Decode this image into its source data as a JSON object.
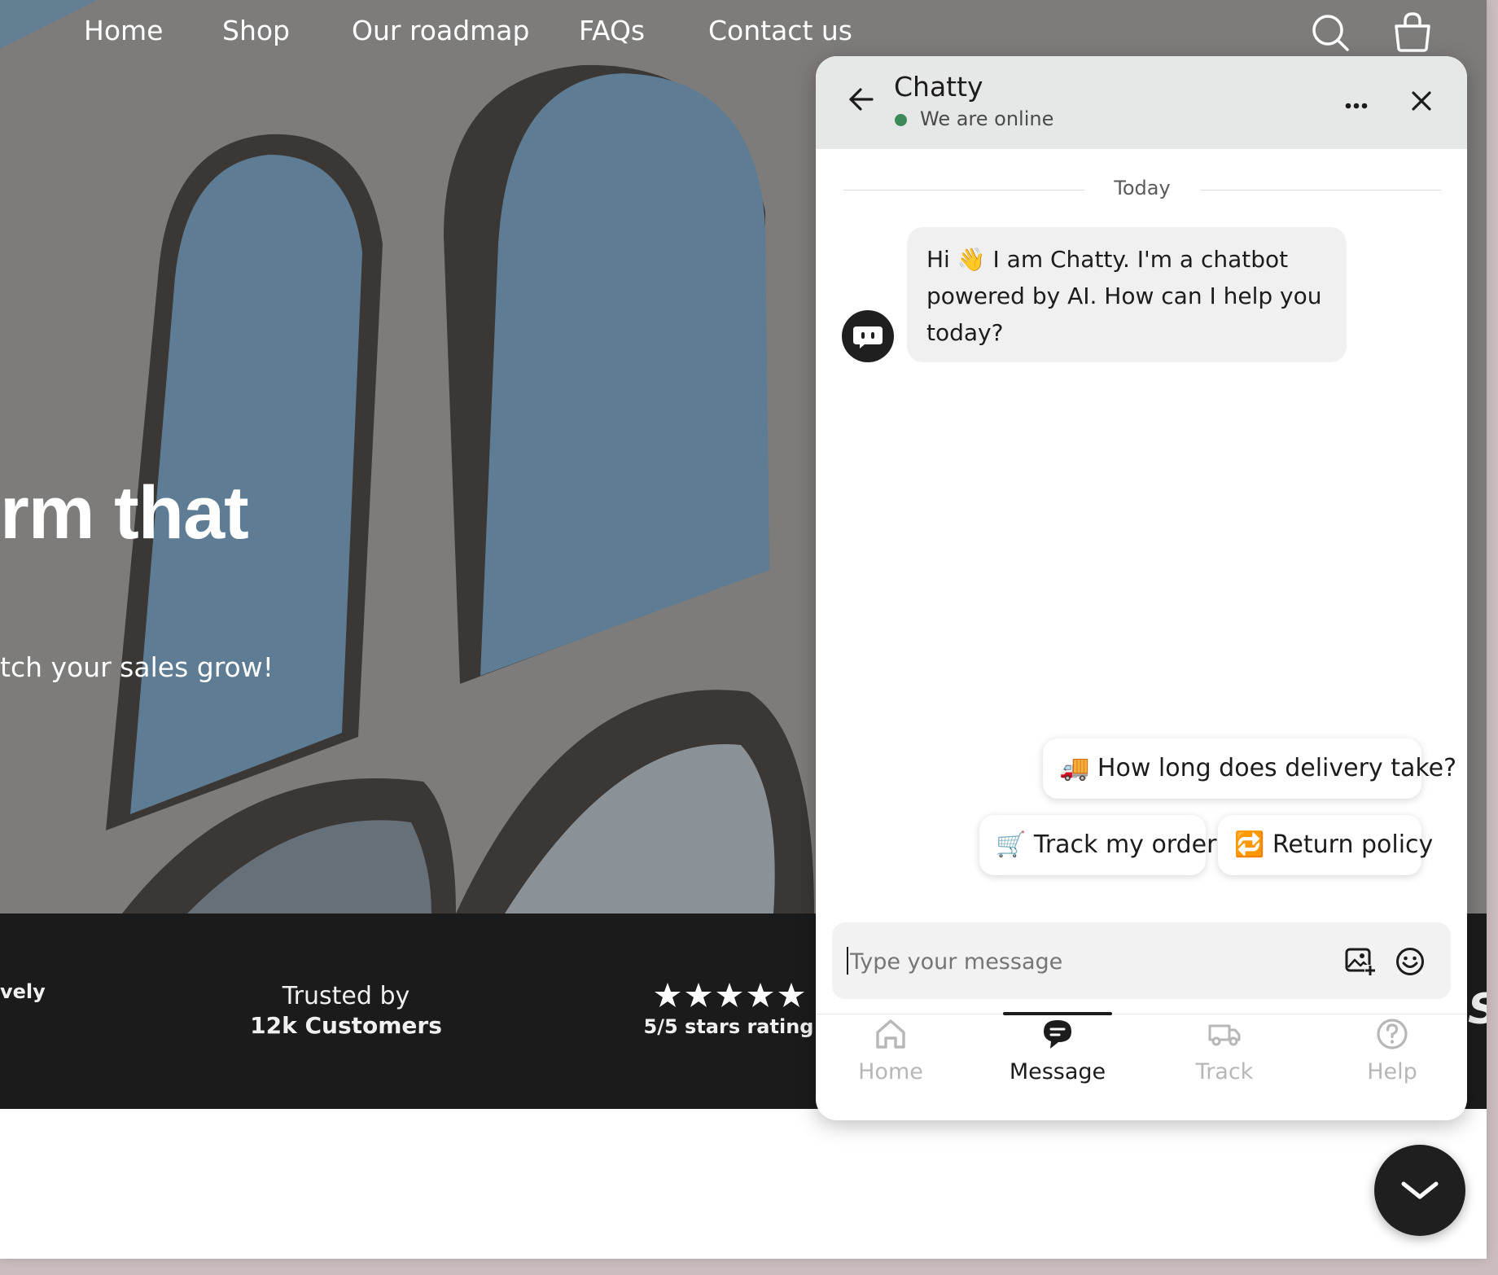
{
  "nav": {
    "items": [
      {
        "label": "Home"
      },
      {
        "label": "Shop"
      },
      {
        "label": "Our roadmap"
      },
      {
        "label": "FAQs"
      },
      {
        "label": "Contact us"
      }
    ],
    "search_icon": "search-icon",
    "cart_icon": "shopping-bag-icon"
  },
  "hero": {
    "headline_fragment": "rm that",
    "subtext_fragment": "tch your sales grow!"
  },
  "trust_bar": {
    "left_fragment": "vely",
    "trusted_line1": "Trusted by",
    "trusted_line2": "12k Customers",
    "stars_value": 5,
    "stars_max": 5,
    "rating_label": "5/5 stars rating",
    "right_logo_letter": "S"
  },
  "chat": {
    "title": "Chatty",
    "status": "We are online",
    "status_color": "#3c8a5a",
    "date_divider": "Today",
    "bot_message": "Hi 👋 I am Chatty. I'm a chatbot powered by AI. How can I help you today?",
    "quick_replies": [
      {
        "emoji": "🚚",
        "label": "How long does delivery take?"
      },
      {
        "emoji": "🛒",
        "label": "Track my order"
      },
      {
        "emoji": "🔁",
        "label": "Return policy"
      }
    ],
    "input_placeholder": "Type your message",
    "tabs": [
      {
        "label": "Home",
        "icon": "home-icon",
        "active": false
      },
      {
        "label": "Message",
        "icon": "message-icon",
        "active": true
      },
      {
        "label": "Track",
        "icon": "truck-icon",
        "active": false
      },
      {
        "label": "Help",
        "icon": "help-icon",
        "active": false
      }
    ]
  },
  "launcher": {
    "icon": "chevron-down-icon"
  }
}
